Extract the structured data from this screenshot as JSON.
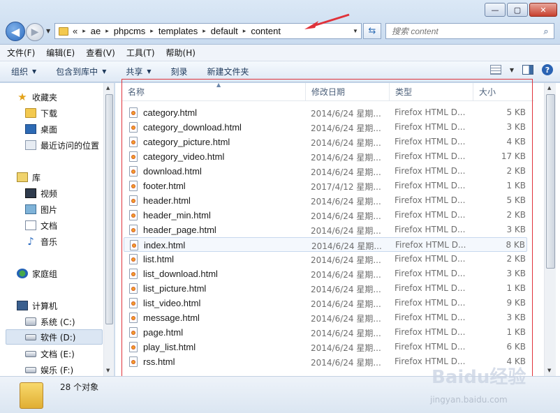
{
  "window": {
    "minimize_glyph": "—",
    "maximize_glyph": "▢",
    "close_glyph": "✕"
  },
  "address": {
    "overflow_glyph": "«",
    "breadcrumbs": [
      "ae",
      "phpcms",
      "templates",
      "default",
      "content"
    ],
    "separator": "▸"
  },
  "search": {
    "placeholder": "搜索 content"
  },
  "menubar": {
    "items": [
      "文件(F)",
      "编辑(E)",
      "查看(V)",
      "工具(T)",
      "帮助(H)"
    ]
  },
  "commandbar": {
    "organize": "组织",
    "include_in_library": "包含到库中",
    "share": "共享",
    "burn": "刻录",
    "new_folder": "新建文件夹"
  },
  "navigation": {
    "favorites": "收藏夹",
    "downloads": "下载",
    "desktop": "桌面",
    "recent": "最近访问的位置",
    "libraries": "库",
    "videos": "视频",
    "pictures": "图片",
    "documents": "文档",
    "music": "音乐",
    "homegroup": "家庭组",
    "computer": "计算机",
    "drive_c": "系统 (C:)",
    "drive_d": "软件 (D:)",
    "drive_e": "文档 (E:)",
    "drive_f": "娱乐 (F:)"
  },
  "columns": {
    "name": "名称",
    "date": "修改日期",
    "type": "类型",
    "size": "大小"
  },
  "files": [
    {
      "name": "category.html",
      "date": "2014/6/24 星期...",
      "type": "Firefox HTML D...",
      "size": "5 KB"
    },
    {
      "name": "category_download.html",
      "date": "2014/6/24 星期...",
      "type": "Firefox HTML D...",
      "size": "3 KB"
    },
    {
      "name": "category_picture.html",
      "date": "2014/6/24 星期...",
      "type": "Firefox HTML D...",
      "size": "4 KB"
    },
    {
      "name": "category_video.html",
      "date": "2014/6/24 星期...",
      "type": "Firefox HTML D...",
      "size": "17 KB"
    },
    {
      "name": "download.html",
      "date": "2014/6/24 星期...",
      "type": "Firefox HTML D...",
      "size": "2 KB"
    },
    {
      "name": "footer.html",
      "date": "2017/4/12 星期...",
      "type": "Firefox HTML D...",
      "size": "1 KB"
    },
    {
      "name": "header.html",
      "date": "2014/6/24 星期...",
      "type": "Firefox HTML D...",
      "size": "5 KB"
    },
    {
      "name": "header_min.html",
      "date": "2014/6/24 星期...",
      "type": "Firefox HTML D...",
      "size": "2 KB"
    },
    {
      "name": "header_page.html",
      "date": "2014/6/24 星期...",
      "type": "Firefox HTML D...",
      "size": "3 KB"
    },
    {
      "name": "index.html",
      "date": "2014/6/24 星期...",
      "type": "Firefox HTML D...",
      "size": "8 KB"
    },
    {
      "name": "list.html",
      "date": "2014/6/24 星期...",
      "type": "Firefox HTML D...",
      "size": "2 KB"
    },
    {
      "name": "list_download.html",
      "date": "2014/6/24 星期...",
      "type": "Firefox HTML D...",
      "size": "3 KB"
    },
    {
      "name": "list_picture.html",
      "date": "2014/6/24 星期...",
      "type": "Firefox HTML D...",
      "size": "1 KB"
    },
    {
      "name": "list_video.html",
      "date": "2014/6/24 星期...",
      "type": "Firefox HTML D...",
      "size": "9 KB"
    },
    {
      "name": "message.html",
      "date": "2014/6/24 星期...",
      "type": "Firefox HTML D...",
      "size": "3 KB"
    },
    {
      "name": "page.html",
      "date": "2014/6/24 星期...",
      "type": "Firefox HTML D...",
      "size": "1 KB"
    },
    {
      "name": "play_list.html",
      "date": "2014/6/24 星期...",
      "type": "Firefox HTML D...",
      "size": "6 KB"
    },
    {
      "name": "rss.html",
      "date": "2014/6/24 星期...",
      "type": "Firefox HTML D...",
      "size": "4 KB"
    }
  ],
  "selected_file": "index.html",
  "details": {
    "count": "28 个对象"
  },
  "watermark": {
    "brand": "Baidu经验",
    "site": "jingyan.baidu.com"
  },
  "colors": {
    "annotation": "#e0323a",
    "chrome": "#c9dbef"
  }
}
